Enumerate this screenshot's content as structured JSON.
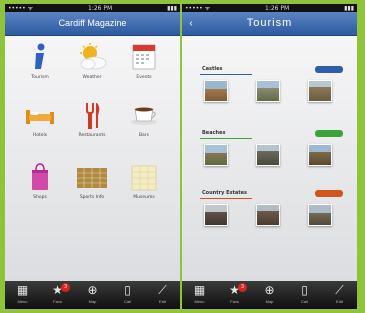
{
  "left_screen": {
    "status": {
      "left": "••••• ᯤ",
      "time": "1:26 PM",
      "battery": "▮▮▮"
    },
    "title": "Cardiff Magazine",
    "items": [
      {
        "label": "Tourism",
        "icon": "info-icon"
      },
      {
        "label": "Weather",
        "icon": "weather-icon"
      },
      {
        "label": "Events",
        "icon": "calendar-icon"
      },
      {
        "label": "Hotels",
        "icon": "bed-icon"
      },
      {
        "label": "Restaurants",
        "icon": "cutlery-icon"
      },
      {
        "label": "Bars",
        "icon": "coffee-icon"
      },
      {
        "label": "Shops",
        "icon": "shopping-bag-icon"
      },
      {
        "label": "Sports Info",
        "icon": "sports-court-icon"
      },
      {
        "label": "Museums",
        "icon": "museum-icon"
      }
    ]
  },
  "right_screen": {
    "status": {
      "left": "••••• ᯤ",
      "time": "1:26 PM",
      "battery": "▮▮▮"
    },
    "title": "Tourism",
    "back_label": "‹",
    "sections": [
      {
        "title": "Castles",
        "color": "#2f5db0"
      },
      {
        "title": "Beaches",
        "color": "#3ca33a"
      },
      {
        "title": "Country Estates",
        "color": "#d2541e"
      }
    ]
  },
  "tabbar": {
    "tabs": [
      {
        "label": "Menu",
        "icon": "grid-icon",
        "glyph": "▦"
      },
      {
        "label": "Favs",
        "icon": "star-icon",
        "glyph": "★",
        "badge": "3"
      },
      {
        "label": "Map",
        "icon": "globe-icon",
        "glyph": "⊕"
      },
      {
        "label": "Call",
        "icon": "phone-icon",
        "glyph": "▯"
      },
      {
        "label": "Edit",
        "icon": "pencil-icon",
        "glyph": "⟋"
      }
    ]
  },
  "colors": {
    "background": "#8fc43a",
    "navbar": "#2e5aa0",
    "tabbar": "#1a1a1a"
  }
}
